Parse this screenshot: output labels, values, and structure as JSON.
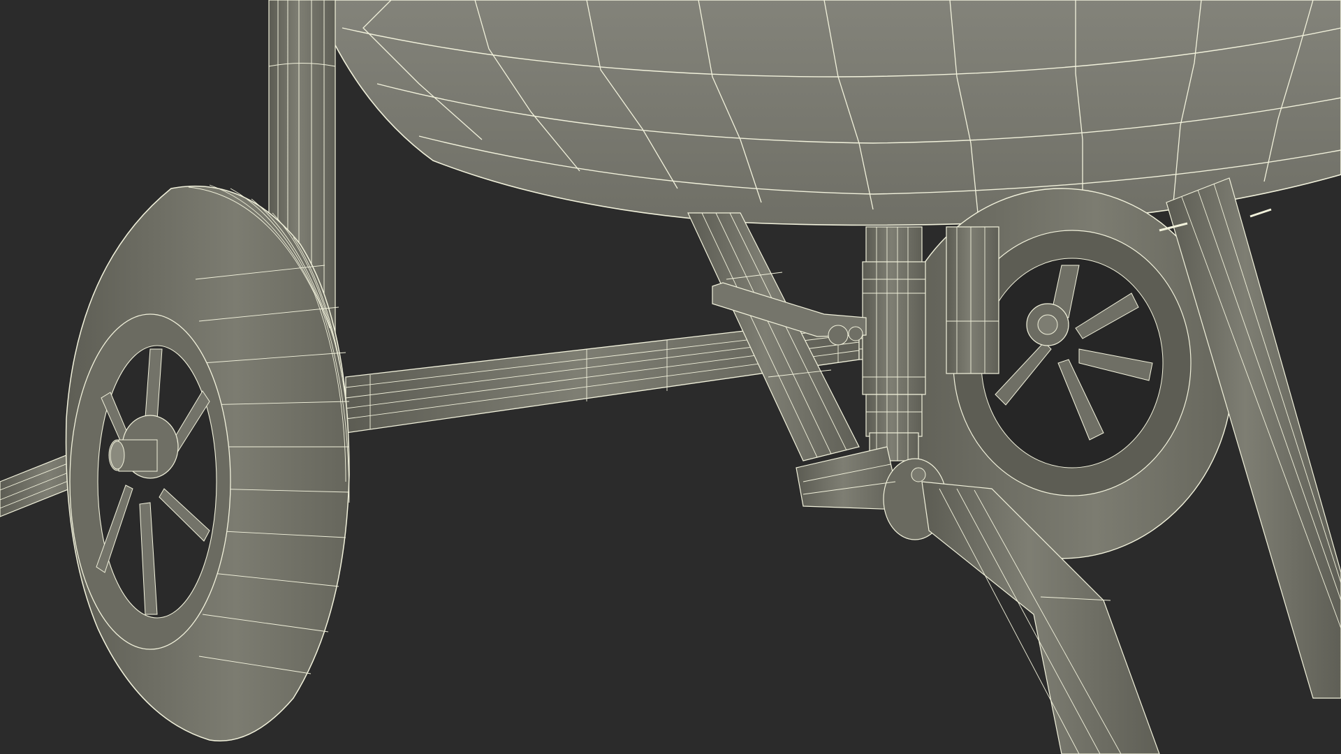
{
  "scene": {
    "background_color": "#2b2b2b",
    "mesh_fill": "#7a7a6e",
    "mesh_fill_dark": "#5f5f55",
    "mesh_fill_light": "#8a8a7e",
    "wire_color": "#f2f2dc",
    "shadow_color": "#1e1e1e",
    "icons": [
      "wheel-icon",
      "axle-icon",
      "drum-icon",
      "leg-icon"
    ]
  }
}
